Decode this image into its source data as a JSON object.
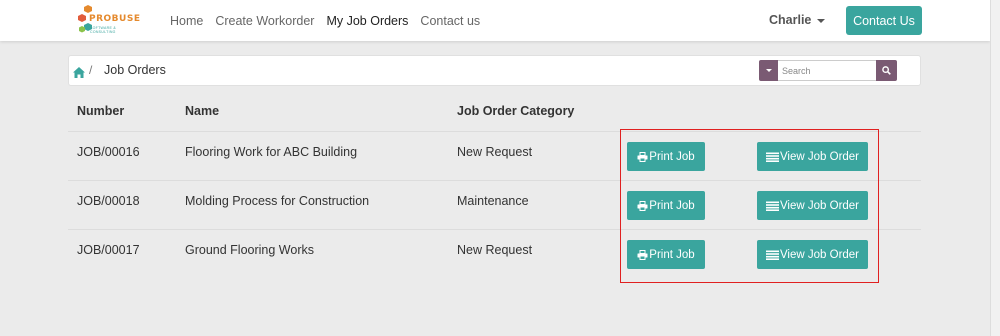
{
  "brand": {
    "name": "PROBUSE",
    "tagline": "SOFTWARE & CONSULTING"
  },
  "nav": {
    "links": [
      {
        "label": "Home"
      },
      {
        "label": "Create Workorder"
      },
      {
        "label": "My Job Orders",
        "active": true
      },
      {
        "label": "Contact us"
      }
    ],
    "user": "Charlie",
    "contact_button": "Contact Us"
  },
  "breadcrumb": {
    "separator": "/",
    "title": "Job Orders"
  },
  "search": {
    "placeholder": "Search"
  },
  "table": {
    "columns": [
      "Number",
      "Name",
      "Job Order Category"
    ],
    "rows": [
      {
        "number": "JOB/00016",
        "name": "Flooring Work for ABC Building",
        "category": "New Request"
      },
      {
        "number": "JOB/00018",
        "name": "Molding Process for Construction",
        "category": "Maintenance"
      },
      {
        "number": "JOB/00017",
        "name": "Ground Flooring Works",
        "category": "New Request"
      }
    ],
    "print_label": "Print Job",
    "view_label": "View Job Order"
  },
  "colors": {
    "accent": "#3aa59e",
    "search_accent": "#7a5a73",
    "highlight": "#e02020"
  }
}
